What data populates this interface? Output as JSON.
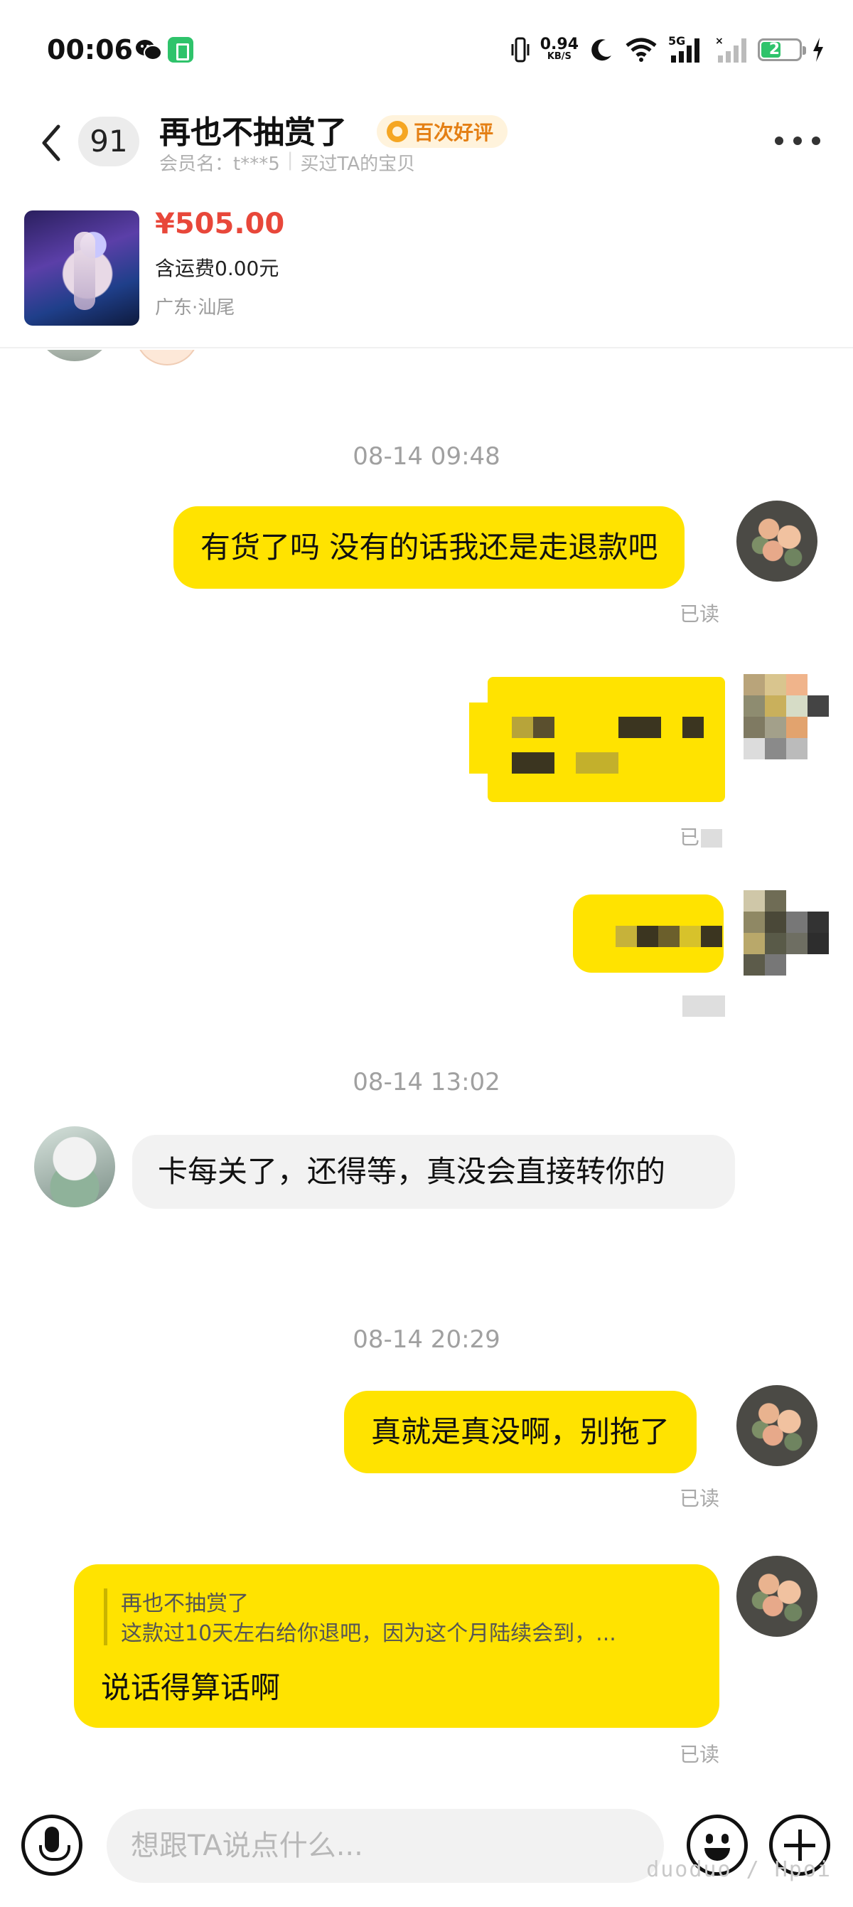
{
  "status_bar": {
    "time": "00:06",
    "net_speed": "0.94",
    "net_speed_unit": "KB/S",
    "network": "5G",
    "battery": "27"
  },
  "header": {
    "unread_count": "91",
    "shop_name": "再也不抽赏了",
    "badge": "百次好评",
    "member_label": "会员名：t***5",
    "bought_label": "买过TA的宝贝"
  },
  "product": {
    "price": "¥505.00",
    "shipping": "含运费0.00元",
    "location": "广东·汕尾"
  },
  "messages": {
    "time1": "08-14 09:48",
    "msg1": "有货了吗 没有的话我还是走退款吧",
    "read1": "已读",
    "read2": "已",
    "time2": "08-14 13:02",
    "msg_seller": "卡每关了，还得等，真没会直接转你的",
    "time3": "08-14 20:29",
    "msg3": "真就是真没啊，别拖了",
    "read3": "已读",
    "quote_author": "再也不抽赏了",
    "quote_text": "这款过10天左右给你退吧，因为这个月陆续会到，...",
    "msg4": "说话得算话啊",
    "read4": "已读"
  },
  "input": {
    "placeholder": "想跟TA说点什么..."
  },
  "watermark": "duoduo / Hpoi",
  "colors": {
    "bubble_me": "#ffe300",
    "bubble_seller": "#f2f2f2",
    "price": "#e8473a",
    "badge": "#e47f14"
  }
}
